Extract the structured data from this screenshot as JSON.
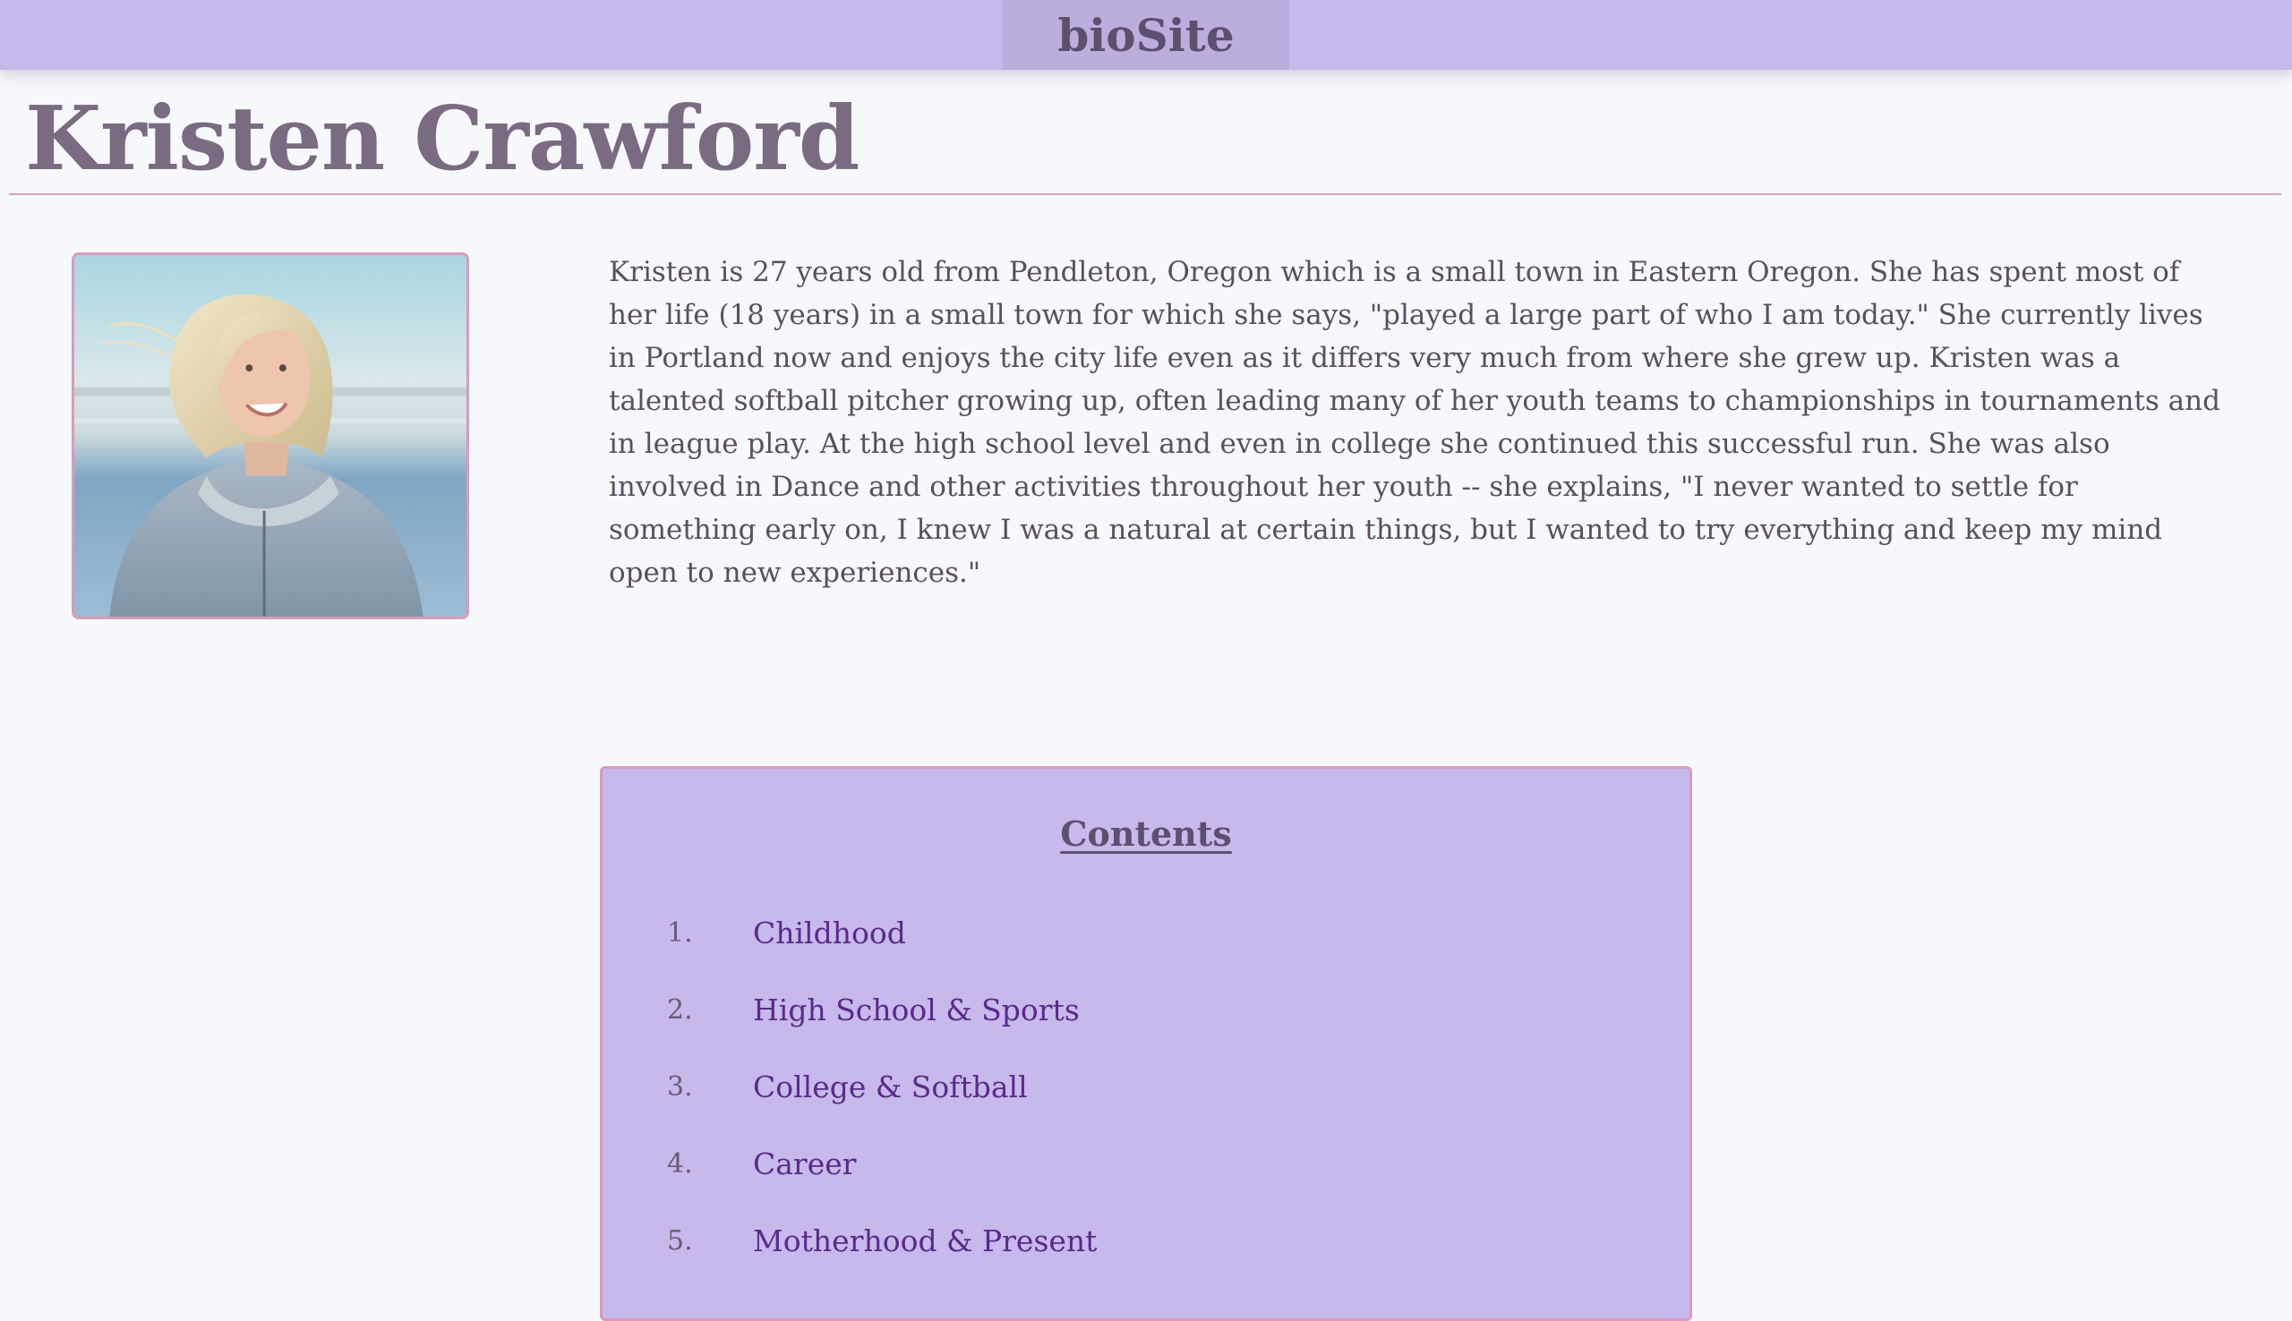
{
  "header": {
    "brand": "bioSite"
  },
  "page": {
    "title": "Kristen Crawford"
  },
  "bio": {
    "text": "Kristen is 27 years old from Pendleton, Oregon which is a small town in Eastern Oregon. She has spent most of her life (18 years) in a small town for which she says, \"played a large part of who I am today.\" She currently lives in Portland now and enjoys the city life even as it differs very much from where she grew up. Kristen was a talented softball pitcher growing up, often leading many of her youth teams to championships in tournaments and in league play. At the high school level and even in college she continued this successful run. She was also involved in Dance and other activities throughout her youth -- she explains, \"I never wanted to settle for something early on, I knew I was a natural at certain things, but I wanted to try everything and keep my mind open to new experiences.\""
  },
  "contents": {
    "title": "Contents",
    "items": [
      {
        "number": "1.",
        "label": "Childhood"
      },
      {
        "number": "2.",
        "label": "High School & Sports"
      },
      {
        "number": "3.",
        "label": "College & Softball"
      },
      {
        "number": "4.",
        "label": "Career"
      },
      {
        "number": "5.",
        "label": "Motherhood & Present"
      }
    ]
  },
  "colors": {
    "header_bg": "#c7b9eb",
    "brand_box_bg": "#bcaddf",
    "title_text": "#7a6a82",
    "rule": "#d7a3c4",
    "link": "#5a2a8a",
    "page_bg": "#f7f8fc"
  }
}
